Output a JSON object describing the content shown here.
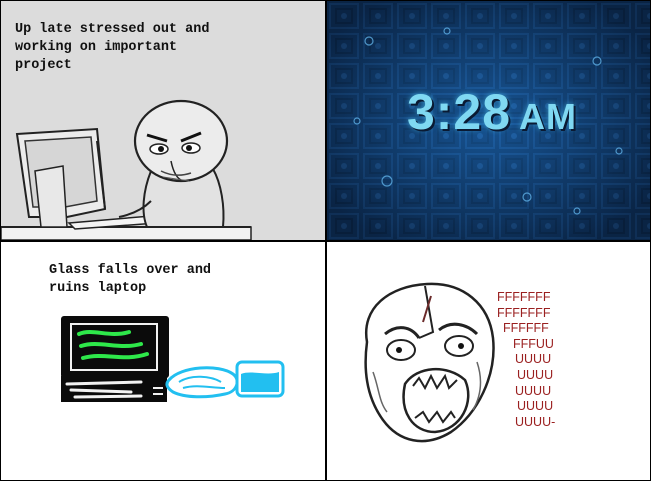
{
  "panels": {
    "p1": {
      "caption": "Up late stressed out and\nworking on important\nproject"
    },
    "p2": {
      "clock": {
        "time": "3:28",
        "ampm": "AM"
      }
    },
    "p3": {
      "caption": "Glass falls over and\nruins laptop"
    },
    "p4": {
      "rage_lines": [
        "FFFFFFF",
        "FFFFFFF",
        "FFFFFF",
        "FFFUU",
        "UUUU",
        "UUUU",
        "UUUU",
        "UUUU",
        "UUUU-"
      ]
    }
  },
  "colors": {
    "laptop_green": "#2ee84a",
    "water_blue": "#22bff0",
    "rage_red": "#9a1f1f",
    "clock_cyan": "#7fd8f2"
  }
}
